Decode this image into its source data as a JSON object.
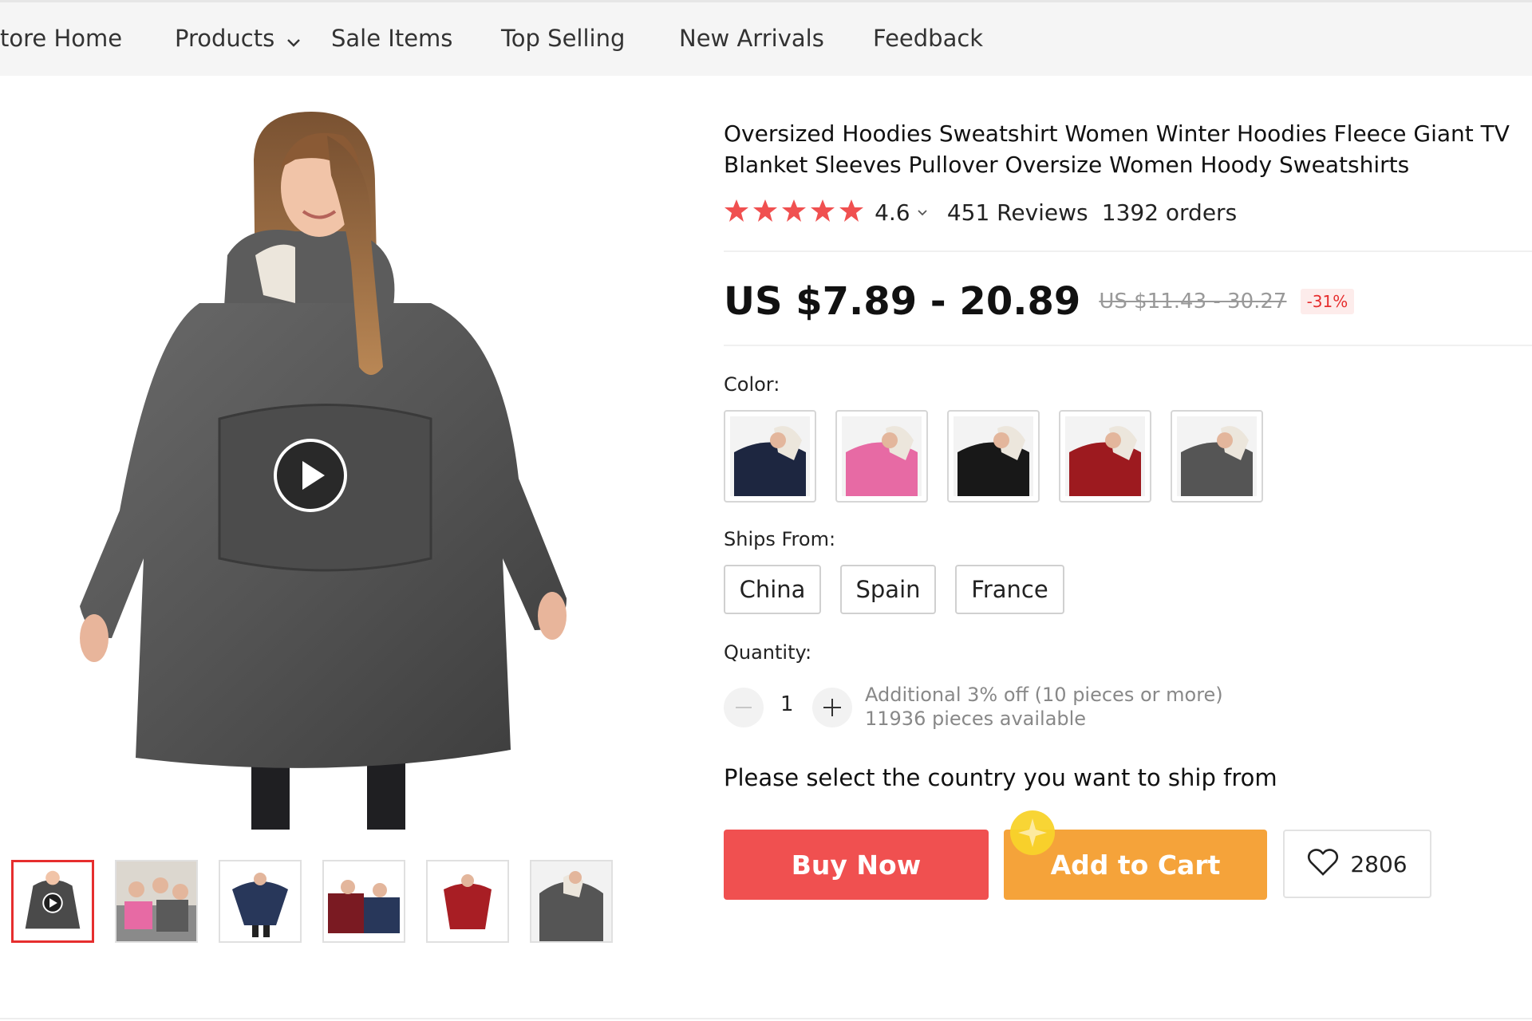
{
  "nav": {
    "store_home": "tore Home",
    "products": "Products",
    "sale_items": "Sale Items",
    "top_selling": "Top Selling",
    "new_arrivals": "New Arrivals",
    "feedback": "Feedback"
  },
  "product": {
    "title": "Oversized Hoodies Sweatshirt Women Winter Hoodies Fleece Giant TV Blanket Sleeves Pullover Oversize Women Hoody Sweatshirts",
    "rating": "4.6",
    "stars": 5,
    "reviews": "451 Reviews",
    "orders": "1392 orders",
    "price": "US $7.89 - 20.89",
    "original_price": "US $11.43 - 30.27",
    "discount": "-31%"
  },
  "colors": {
    "label": "Color:",
    "options": [
      "navy",
      "pink",
      "black",
      "red",
      "gray"
    ],
    "swatch_hex": [
      "#1d2640",
      "#e76aa4",
      "#181818",
      "#9d1a1f",
      "#555555"
    ]
  },
  "ships_from": {
    "label": "Ships From:",
    "options": [
      "China",
      "Spain",
      "France"
    ]
  },
  "quantity": {
    "label": "Quantity:",
    "value": "1",
    "additional": "Additional 3% off (10 pieces or more)",
    "available": "11936 pieces available"
  },
  "ship_message": "Please select the country you want to ship from",
  "actions": {
    "buy_now": "Buy Now",
    "add_to_cart": "Add to Cart",
    "wishlist_count": "2806"
  },
  "gallery": {
    "thumb_colors": [
      "#4a4a4a",
      "#6b6b6b",
      "#28375a",
      "#7a1a22",
      "#a81e24",
      "#555555"
    ]
  },
  "theme": {
    "accent_red": "#f05050",
    "accent_orange": "#f5a33a",
    "discount_red": "#e62e2e"
  }
}
